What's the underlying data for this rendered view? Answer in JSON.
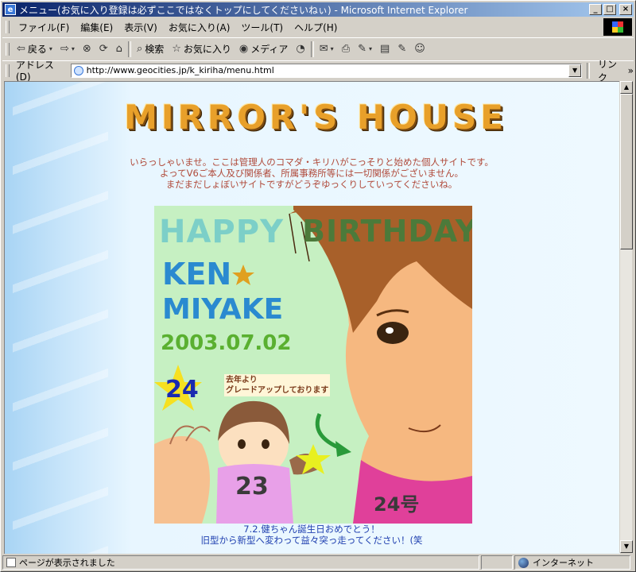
{
  "window": {
    "title": "メニュー(お気に入り登録は必ずここではなくトップにしてくださいねぃ) - Microsoft Internet Explorer",
    "min_glyph": "_",
    "max_glyph": "□",
    "close_glyph": "×"
  },
  "menu": [
    "ファイル(F)",
    "編集(E)",
    "表示(V)",
    "お気に入り(A)",
    "ツール(T)",
    "ヘルプ(H)"
  ],
  "toolbar": {
    "back": "戻る",
    "back_glyph": "⇦",
    "forward_glyph": "⇨",
    "stop_glyph": "⊗",
    "refresh_glyph": "⟳",
    "home_glyph": "⌂",
    "search": "検索",
    "search_glyph": "⌕",
    "favorites": "お気に入り",
    "favorites_glyph": "☆",
    "media": "メディア",
    "media_glyph": "◉",
    "history_glyph": "◔",
    "mail_glyph": "✉",
    "print_glyph": "⎙",
    "edit_glyph": "✎",
    "discuss_glyph": "▤",
    "messenger_glyph": "☺",
    "dropdown_glyph": "▾"
  },
  "address": {
    "label": "アドレス(D)",
    "url": "http://www.geocities.jp/k_kiriha/menu.html",
    "links": "リンク",
    "links_glyph": "»",
    "dropdown_glyph": "▼"
  },
  "page": {
    "banner": "MIRROR'S HOUSE",
    "intro": [
      "いらっしゃいませ。ここは管理人のコマダ・キリハがこっそりと始めた個人サイトです。",
      "よってV6ご本人及び関係者、所属事務所等には一切関係がございません。",
      "まだまだしょぼいサイトですがどうぞゆっくりしていってくださいね。"
    ],
    "art": {
      "happy": "HAPPY",
      "birthday": "BIRTHDAY",
      "name1": "KEN",
      "name2": "MIYAKE",
      "date": "2003.07.02",
      "age": "24",
      "note": [
        "去年より",
        "グレードアップしております"
      ],
      "shirt_old": "23",
      "shirt_new": "24号"
    },
    "caption": [
      "7.2.健ちゃん誕生日おめでとう！",
      "旧型から新型へ変わって益々突っ走ってください！(笑"
    ]
  },
  "scrollbar": {
    "up_glyph": "▲",
    "down_glyph": "▼"
  },
  "status": {
    "message": "ページが表示されました",
    "zone": "インターネット"
  },
  "colors": {
    "titlebar_start": "#0a246a",
    "titlebar_end": "#a6caf0",
    "banner": "#e8a02a",
    "intro_text": "#b04a3a",
    "caption_text": "#2040b0"
  }
}
